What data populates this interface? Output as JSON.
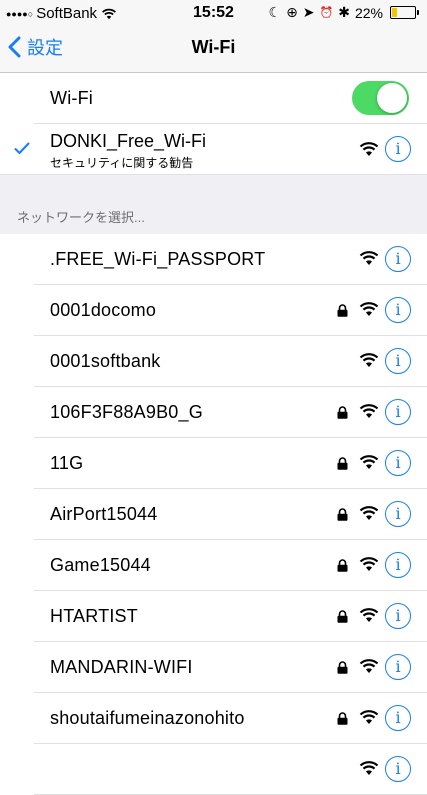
{
  "status_bar": {
    "signal": "●●●●○",
    "carrier": "SoftBank",
    "time": "15:52",
    "moon": "☾",
    "lock_rotation": "⊕",
    "location": "➤",
    "alarm": "⏰",
    "bluetooth": "✱",
    "battery_percent": "22%",
    "battery_level": 0.22,
    "battery_color": "#f5c600"
  },
  "nav": {
    "back_label": "設定",
    "title": "Wi-Fi"
  },
  "wifi_toggle": {
    "label": "Wi-Fi",
    "on": true,
    "color": "#4cd964"
  },
  "connected": {
    "name": "DONKI_Free_Wi-Fi",
    "subtitle": "セキュリティに関する勧告",
    "info": "i"
  },
  "section_header": "ネットワークを選択...",
  "networks": [
    {
      "name": ".FREE_Wi-Fi_PASSPORT",
      "secured": false,
      "info": "i"
    },
    {
      "name": "0001docomo",
      "secured": true,
      "info": "i"
    },
    {
      "name": "0001softbank",
      "secured": false,
      "info": "i"
    },
    {
      "name": "106F3F88A9B0_G",
      "secured": true,
      "info": "i"
    },
    {
      "name": "11G",
      "secured": true,
      "info": "i"
    },
    {
      "name": "AirPort15044",
      "secured": true,
      "info": "i"
    },
    {
      "name": "Game15044",
      "secured": true,
      "info": "i"
    },
    {
      "name": "HTARTIST",
      "secured": true,
      "info": "i"
    },
    {
      "name": "MANDARIN-WIFI",
      "secured": true,
      "info": "i"
    },
    {
      "name": "shoutaifumeinazonohito",
      "secured": true,
      "info": "i"
    },
    {
      "name": "",
      "secured": false,
      "info": "i"
    }
  ],
  "accent_color": "#157efb"
}
